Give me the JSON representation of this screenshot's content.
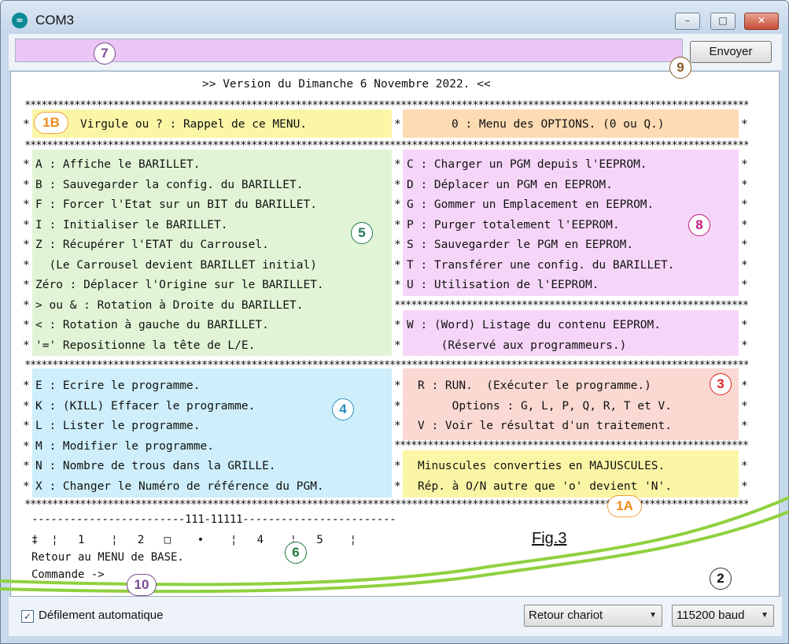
{
  "window": {
    "title": "COM3",
    "app_icon": "arduino-logo-icon",
    "controls": [
      "–",
      "□",
      "✕"
    ]
  },
  "toolbar": {
    "send_value": "",
    "send_label": "Envoyer"
  },
  "output": {
    "version": ">> Version du Dimanche 6 Novembre 2022. <<",
    "rappel": "Virgule ou ? : Rappel de ce MENU.",
    "options_menu": "0 : Menu des OPTIONS. (0 ou Q.)",
    "barillet": [
      "A : Affiche le BARILLET.",
      "B : Sauvegarder la config. du BARILLET.",
      "F : Forcer l'Etat sur un BIT du BARILLET.",
      "I : Initialiser le BARILLET.",
      "Z : Récupérer l'ETAT du Carrousel.",
      "  (Le Carrousel devient BARILLET initial)",
      "Zéro : Déplacer l'Origine sur le BARILLET.",
      "> ou & : Rotation à Droite du BARILLET.",
      "< : Rotation à gauche du BARILLET.",
      "'=' Repositionne la tête de L/E."
    ],
    "eeprom": [
      "C : Charger un PGM depuis l'EEPROM.",
      "D : Déplacer un PGM en EEPROM.",
      "G : Gommer un Emplacement en EEPROM.",
      "P : Purger totalement l'EEPROM.",
      "S : Sauvegarder le PGM en EEPROM.",
      "T : Transférer une config. du BARILLET.",
      "U : Utilisation de l'EEPROM."
    ],
    "word": [
      "W : (Word) Listage du contenu EEPROM.",
      "     (Réservé aux programmeurs.)"
    ],
    "programme": [
      "E : Ecrire le programme.",
      "K : (KILL) Effacer le programme.",
      "L : Lister le programme.",
      "M : Modifier le programme.",
      "N : Nombre de trous dans la GRILLE.",
      "X : Changer le Numéro de référence du PGM."
    ],
    "run": [
      "R : RUN.  (Exécuter le programme.)",
      "     Options : G, L, P, Q, R, T et V.",
      "V : Voir le résultat d'un traitement."
    ],
    "majuscules": [
      "Minuscules converties en MAJUSCULES.",
      "Rép. à O/N autre que 'o' devient 'N'."
    ],
    "barillet_line": "------------------------111-11111------------------------",
    "ruler": "‡  ¦   1    ¦   2   □    •    ¦   4    ¦   5    ¦",
    "retour": "Retour au MENU de BASE.",
    "commande": "Commande ->"
  },
  "annotations": {
    "fig": "Fig.3",
    "badges": [
      "1B",
      "1A",
      "2",
      "3",
      "4",
      "5",
      "6",
      "7",
      "8",
      "9",
      "10"
    ]
  },
  "colors": {
    "yellow": "#fbf6a6",
    "orange": "#fddcb4",
    "green": "#e1f5d6",
    "pink": "#f6d6f8",
    "blue": "#cdeefa",
    "salmon": "#fbd9d3",
    "input_purple": "#e9c6f5",
    "stroke_green": "#8fd13f"
  },
  "statusbar": {
    "autoscroll_checked": true,
    "autoscroll_label": "Défilement automatique",
    "line_ending": "Retour chariot",
    "baud": "115200 baud"
  }
}
